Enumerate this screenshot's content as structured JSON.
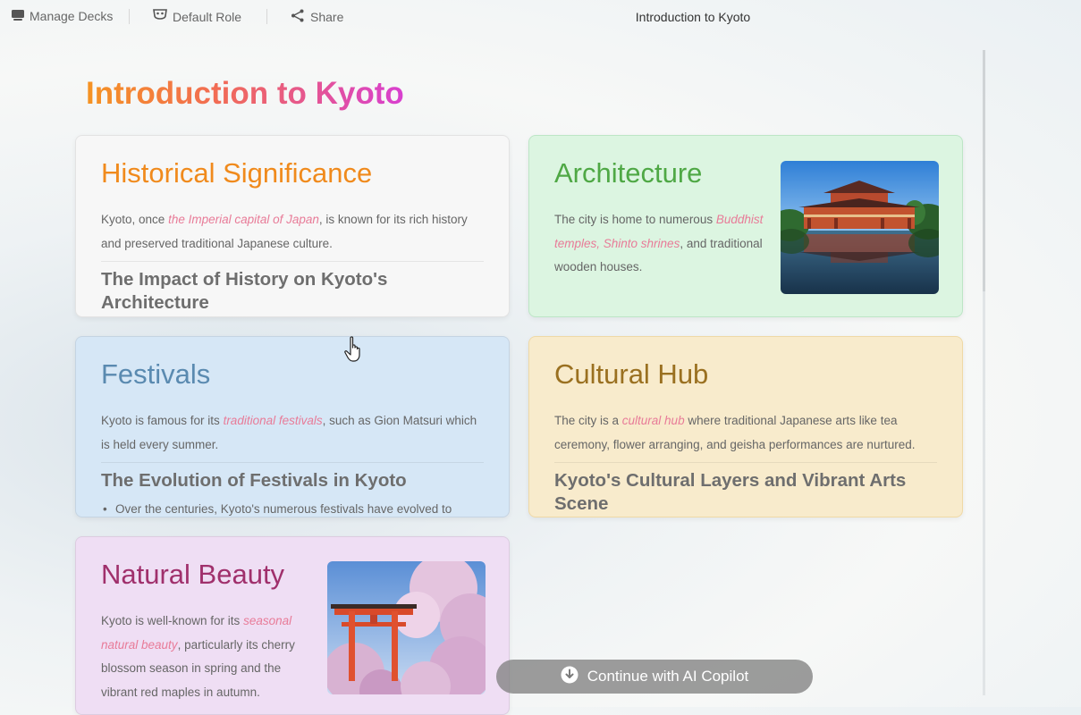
{
  "topbar": {
    "manage_decks": "Manage Decks",
    "default_role": "Default Role",
    "share": "Share",
    "title": "Introduction to Kyoto"
  },
  "page": {
    "title": "Introduction to Kyoto"
  },
  "cards": {
    "historical": {
      "title": "Historical Significance",
      "text_before": "Kyoto, once ",
      "highlight": "the Imperial capital of Japan",
      "text_after": ", is known for its rich history and preserved traditional Japanese culture.",
      "subheading": "The Impact of History on Kyoto's Architecture"
    },
    "architecture": {
      "title": "Architecture",
      "text_before": "The city is home to numerous ",
      "highlight": "Buddhist temples, Shinto shrines",
      "text_after": ", and traditional wooden houses."
    },
    "festivals": {
      "title": "Festivals",
      "text_before": "Kyoto is famous for its ",
      "highlight": "traditional festivals",
      "text_after": ", such as Gion Matsuri which is held every summer.",
      "subheading": "The Evolution of Festivals in Kyoto",
      "bullet": "Over the centuries, Kyoto's numerous festivals have evolved to"
    },
    "cultural": {
      "title": "Cultural Hub",
      "text_before": "The city is a ",
      "highlight": "cultural hub",
      "text_after": " where traditional Japanese arts like tea ceremony, flower arranging, and geisha performances are nurtured.",
      "subheading": "Kyoto's Cultural Layers and Vibrant Arts Scene"
    },
    "natural": {
      "title": "Natural Beauty",
      "text_before": "Kyoto is well-known for its ",
      "highlight": "seasonal natural beauty",
      "text_after": ", particularly its cherry blossom season in spring and the vibrant red maples in autumn."
    }
  },
  "copilot": {
    "label": "Continue with AI Copilot"
  },
  "colors": {
    "historical_title": "#f08a1c",
    "architecture_title": "#4fa845",
    "festivals_title": "#5a8ab0",
    "cultural_title": "#9a7020",
    "natural_title": "#a0306c",
    "highlight": "#e87b98"
  },
  "icons": {
    "manage_decks": "deck-icon",
    "default_role": "mask-icon",
    "share": "share-icon",
    "copilot": "download-circle-icon"
  }
}
